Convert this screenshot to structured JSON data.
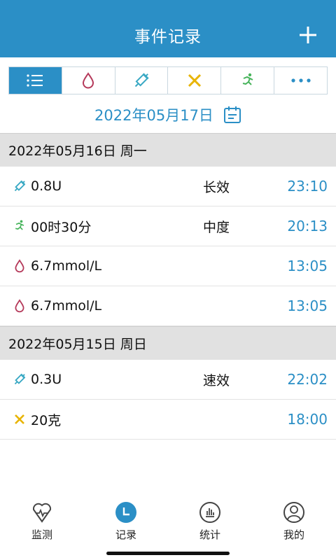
{
  "header": {
    "title": "事件记录"
  },
  "tabs": [
    {
      "name": "list-icon",
      "active": true
    },
    {
      "name": "blood-drop-icon",
      "active": false
    },
    {
      "name": "syringe-icon",
      "active": false
    },
    {
      "name": "fork-knife-icon",
      "active": false
    },
    {
      "name": "running-icon",
      "active": false
    },
    {
      "name": "more-icon",
      "active": false
    }
  ],
  "date_bar": {
    "date": "2022年05月17日"
  },
  "groups": [
    {
      "header": "2022年05月16日 周一",
      "rows": [
        {
          "icon": "syringe-icon",
          "value": "0.8U",
          "tag": "长效",
          "time": "23:10"
        },
        {
          "icon": "running-icon",
          "value": "00时30分",
          "tag": "中度",
          "time": "20:13"
        },
        {
          "icon": "blood-drop-icon",
          "value": "6.7mmol/L",
          "tag": "",
          "time": "13:05"
        },
        {
          "icon": "blood-drop-icon",
          "value": "6.7mmol/L",
          "tag": "",
          "time": "13:05"
        }
      ]
    },
    {
      "header": "2022年05月15日 周日",
      "rows": [
        {
          "icon": "syringe-icon",
          "value": "0.3U",
          "tag": "速效",
          "time": "22:02"
        },
        {
          "icon": "fork-knife-icon",
          "value": "20克",
          "tag": "",
          "time": "18:00"
        }
      ]
    }
  ],
  "nav": [
    {
      "label": "监测",
      "icon": "heart-monitor-icon"
    },
    {
      "label": "记录",
      "icon": "clock-icon",
      "active": true
    },
    {
      "label": "统计",
      "icon": "chart-icon"
    },
    {
      "label": "我的",
      "icon": "user-icon"
    }
  ],
  "colors": {
    "primary": "#2b8fc6",
    "blood": "#b5395a",
    "syringe": "#3aa9c4",
    "food": "#e8b400",
    "exercise": "#46b35a"
  }
}
